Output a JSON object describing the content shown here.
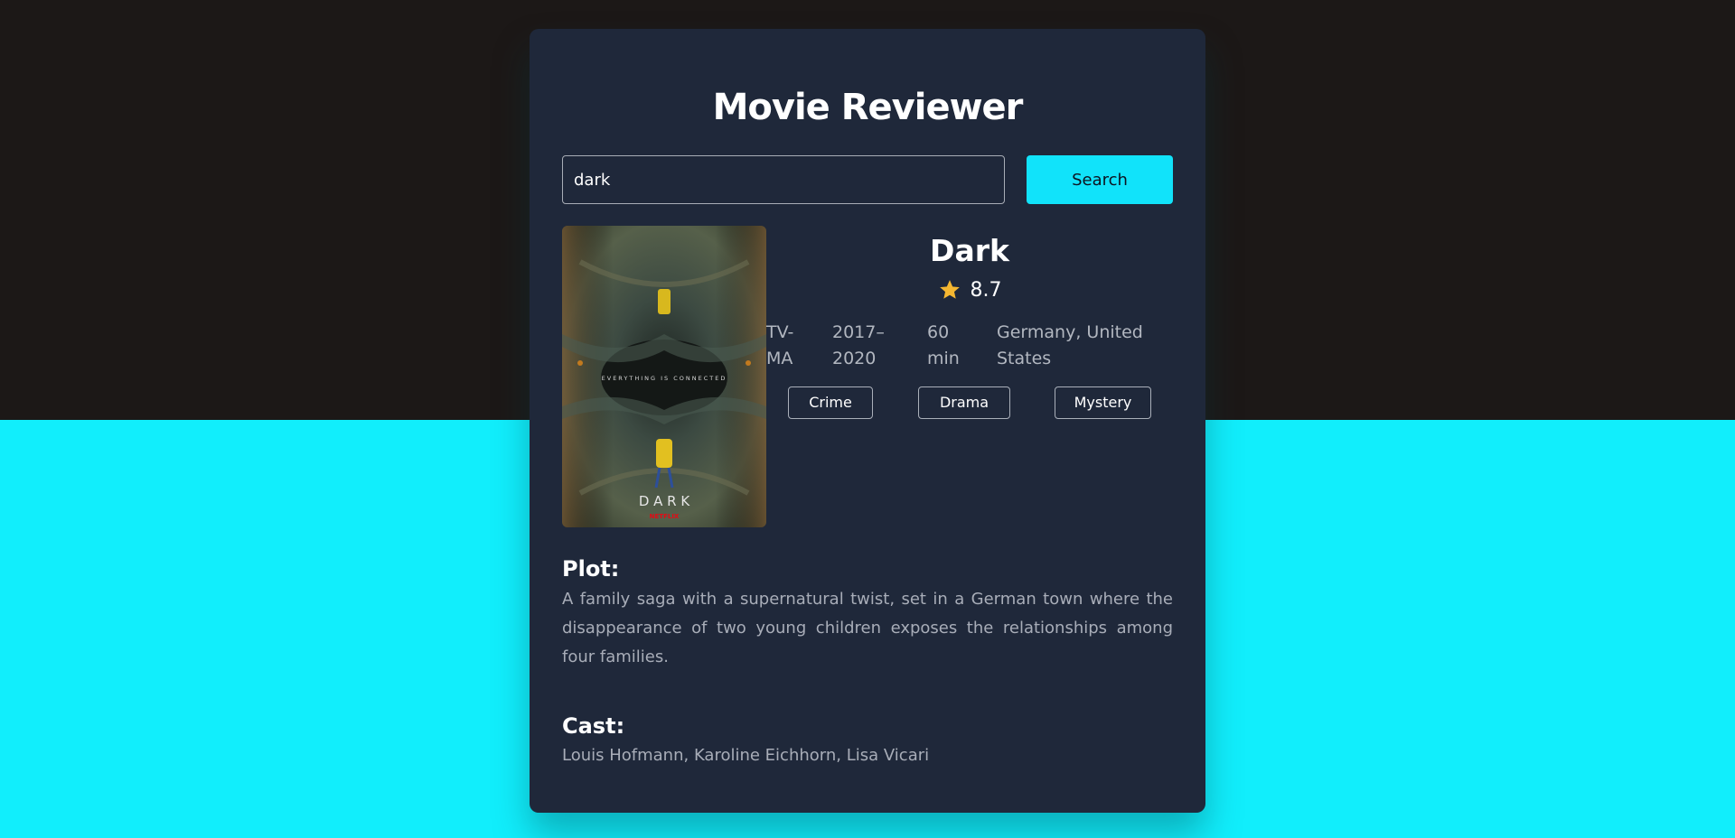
{
  "app": {
    "title": "Movie Reviewer"
  },
  "search": {
    "value": "dark",
    "button_label": "Search"
  },
  "movie": {
    "title": "Dark",
    "rating": "8.7",
    "rated": "TV-MA",
    "years": "2017–2020",
    "runtime": "60 min",
    "country": "Germany, United States",
    "genres": [
      "Crime",
      "Drama",
      "Mystery"
    ],
    "poster": {
      "tagline": "EVERYTHING IS CONNECTED",
      "wordmark": "D A R K",
      "brand": "NETFLIX"
    },
    "plot_heading": "Plot:",
    "plot": "A family saga with a supernatural twist, set in a German town where the disappearance of two young children exposes the relationships among four families.",
    "cast_heading": "Cast:",
    "cast": "Louis Hofmann, Karoline Eichhorn, Lisa Vicari"
  },
  "icons": {
    "rating": "star-icon"
  },
  "colors": {
    "background_top": "#1c1817",
    "background_bottom": "#11eefc",
    "card": "#1f283a",
    "accent": "#11e3fa",
    "star": "#f5b731",
    "text_muted": "#a8adb8"
  }
}
